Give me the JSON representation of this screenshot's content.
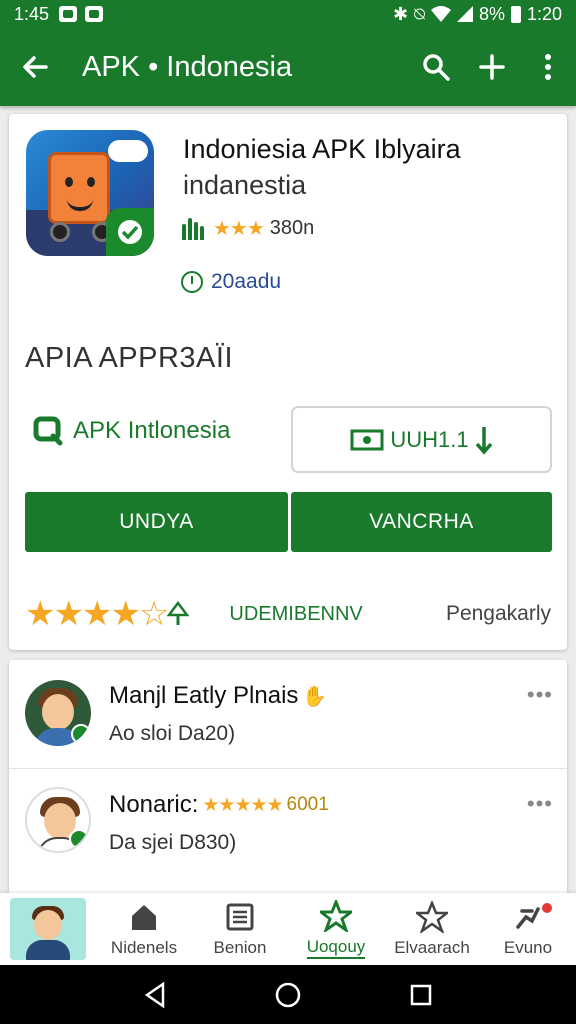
{
  "status": {
    "time": "1:45",
    "battery": "8%",
    "clock": "1:20"
  },
  "appbar": {
    "title": "APK • Indonesia"
  },
  "app": {
    "title": "Indoniesia APK Iblyaira",
    "subtitle": "indanestia",
    "rating_count": "380n",
    "size_label": "20aadu"
  },
  "section_title": "APIA APPR3AÏI",
  "developer": "APK Intlonesia",
  "outline_button": "UUH1.1",
  "buttons": {
    "left": "UNDYA",
    "right": "VANCRHA"
  },
  "bottom_row": {
    "tag": "UDEMIBENNV",
    "right": "Pengakarly"
  },
  "reviews": [
    {
      "name": "Manjl Eatly Plnais",
      "date": "Ao sloi Da20)",
      "more": "•••"
    },
    {
      "name": "Nonaric:",
      "rating_text": "6001",
      "date": "Da sjei D830)",
      "more": "•••"
    }
  ],
  "nav": [
    {
      "label": ""
    },
    {
      "label": "Nidenels"
    },
    {
      "label": "Benion"
    },
    {
      "label": "Uoqouy"
    },
    {
      "label": "Elvaarach"
    },
    {
      "label": "Evuno"
    }
  ],
  "colors": {
    "primary": "#1a7a2c",
    "star": "#f5a623",
    "background": "#ececec"
  }
}
